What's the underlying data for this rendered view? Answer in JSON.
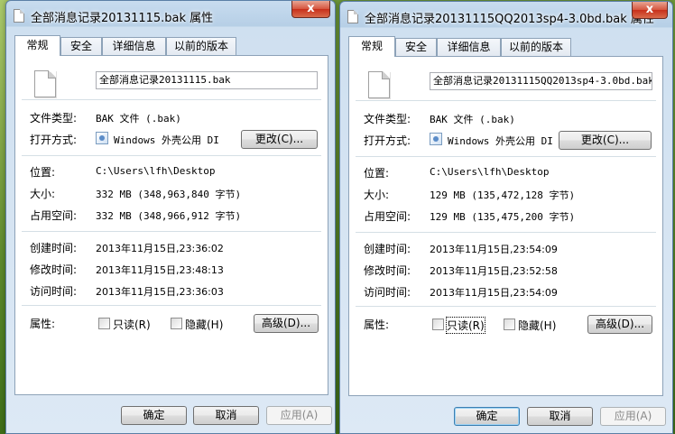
{
  "left": {
    "title": "全部消息记录20131115.bak 属性",
    "close": "x",
    "tabs": [
      "常规",
      "安全",
      "详细信息",
      "以前的版本"
    ],
    "filename": "全部消息记录20131115.bak",
    "file_type_label": "文件类型:",
    "file_type": "BAK 文件 (.bak)",
    "open_with_label": "打开方式:",
    "open_with": "Windows 外壳公用 DI",
    "change_button": "更改(C)...",
    "location_label": "位置:",
    "location": "C:\\Users\\lfh\\Desktop",
    "size_label": "大小:",
    "size": "332 MB (348,963,840 字节)",
    "size_on_disk_label": "占用空间:",
    "size_on_disk": "332 MB (348,966,912 字节)",
    "created_label": "创建时间:",
    "created": "2013年11月15日,23:36:02",
    "modified_label": "修改时间:",
    "modified": "2013年11月15日,23:48:13",
    "accessed_label": "访问时间:",
    "accessed": "2013年11月15日,23:36:03",
    "attributes_label": "属性:",
    "readonly_label": "只读(R)",
    "hidden_label": "隐藏(H)",
    "advanced_button": "高级(D)...",
    "ok_button": "确定",
    "cancel_button": "取消",
    "apply_button": "应用(A)"
  },
  "right": {
    "title": "全部消息记录20131115QQ2013sp4-3.0bd.bak 属性",
    "close": "x",
    "tabs": [
      "常规",
      "安全",
      "详细信息",
      "以前的版本"
    ],
    "filename": "全部消息记录20131115QQ2013sp4-3.0bd.bak",
    "file_type_label": "文件类型:",
    "file_type": "BAK 文件 (.bak)",
    "open_with_label": "打开方式:",
    "open_with": "Windows 外壳公用 DI",
    "change_button": "更改(C)...",
    "location_label": "位置:",
    "location": "C:\\Users\\lfh\\Desktop",
    "size_label": "大小:",
    "size": "129 MB (135,472,128 字节)",
    "size_on_disk_label": "占用空间:",
    "size_on_disk": "129 MB (135,475,200 字节)",
    "created_label": "创建时间:",
    "created": "2013年11月15日,23:54:09",
    "modified_label": "修改时间:",
    "modified": "2013年11月15日,23:52:58",
    "accessed_label": "访问时间:",
    "accessed": "2013年11月15日,23:54:09",
    "attributes_label": "属性:",
    "readonly_label": "只读(R)",
    "hidden_label": "隐藏(H)",
    "advanced_button": "高级(D)...",
    "ok_button": "确定",
    "cancel_button": "取消",
    "apply_button": "应用(A)"
  }
}
